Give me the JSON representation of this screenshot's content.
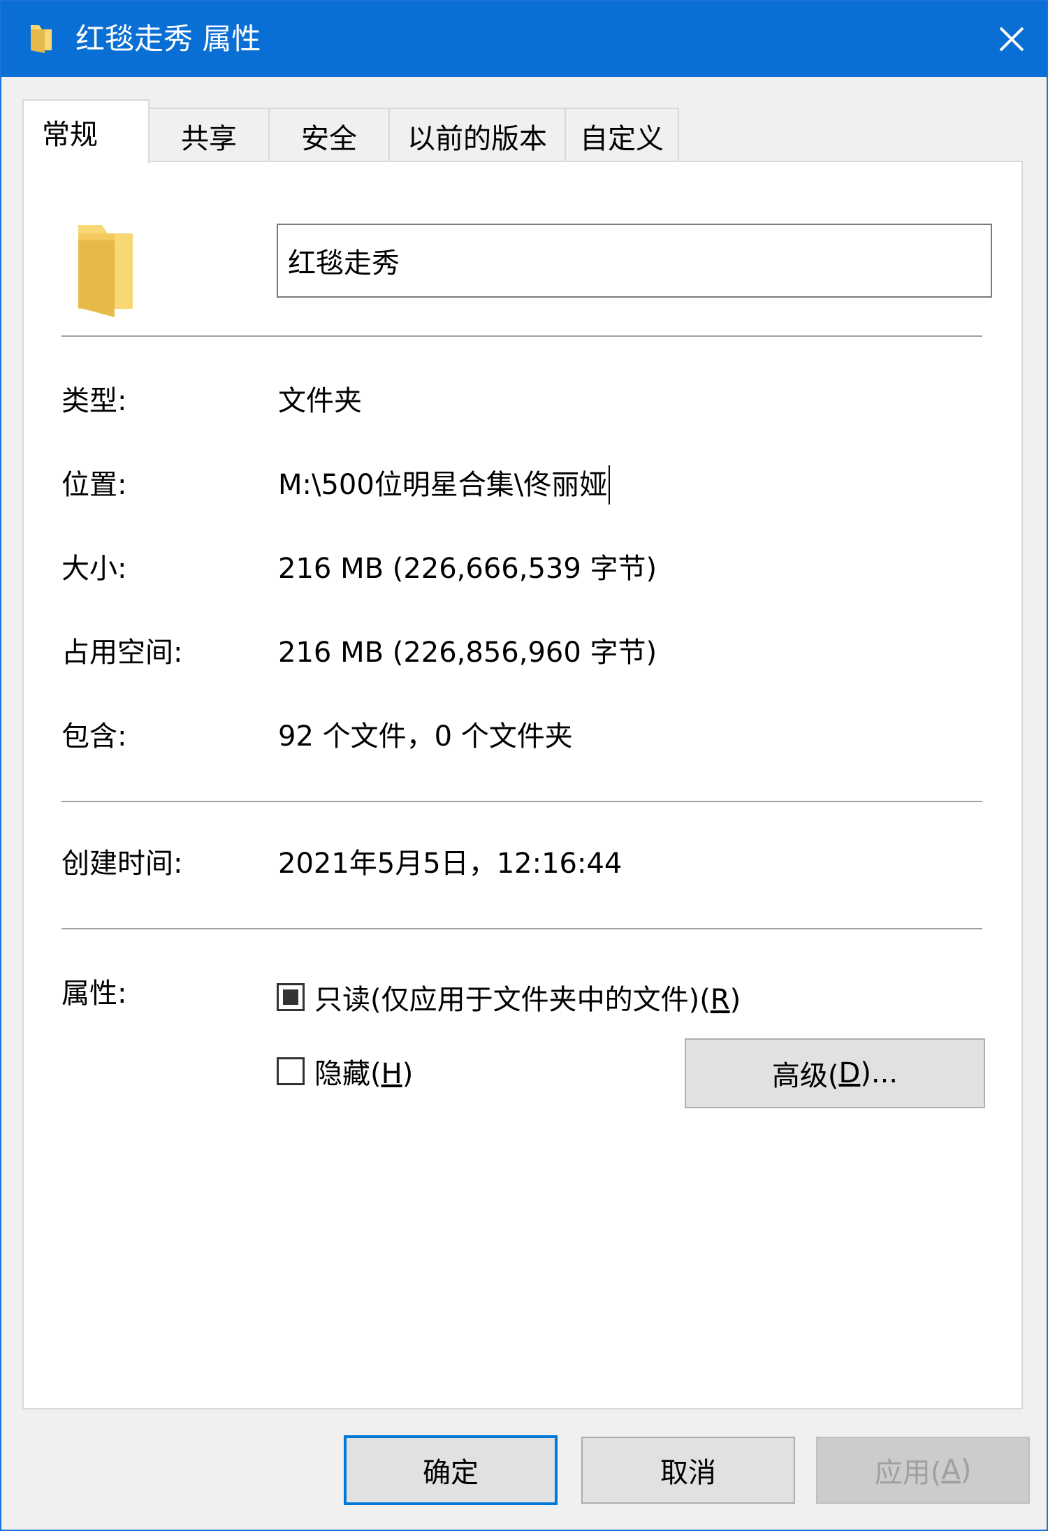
{
  "window": {
    "title": "红毯走秀 属性"
  },
  "tabs": [
    {
      "label": "常规",
      "active": true
    },
    {
      "label": "共享"
    },
    {
      "label": "安全"
    },
    {
      "label": "以前的版本"
    },
    {
      "label": "自定义"
    }
  ],
  "general": {
    "name_value": "红毯走秀",
    "fields": {
      "type_label": "类型:",
      "type_value": "文件夹",
      "location_label": "位置:",
      "location_value": "M:\\500位明星合集\\佟丽娅",
      "size_label": "大小:",
      "size_value": "216 MB (226,666,539 字节)",
      "disk_label": "占用空间:",
      "disk_value": "216 MB (226,856,960 字节)",
      "contains_label": "包含:",
      "contains_value": "92 个文件，0 个文件夹",
      "created_label": "创建时间:",
      "created_value": "2021年5月5日，12:16:44"
    },
    "attributes": {
      "label": "属性:",
      "readonly_text": "只读(仅应用于文件夹中的文件)(",
      "readonly_key": "R",
      "readonly_end": ")",
      "readonly_state": "indeterminate",
      "hidden_text": "隐藏(",
      "hidden_key": "H",
      "hidden_end": ")",
      "hidden_checked": false,
      "advanced_text": "高级(",
      "advanced_key": "D",
      "advanced_end": ")..."
    }
  },
  "footer": {
    "ok_label": "确定",
    "cancel_label": "取消",
    "apply_text": "应用(",
    "apply_key": "A",
    "apply_end": ")",
    "apply_enabled": false
  },
  "colors": {
    "titlebar": "#0a6fd4",
    "accent_border": "#0078d7",
    "folder_yellow": "#f8d775",
    "folder_dark": "#e6b94a"
  }
}
